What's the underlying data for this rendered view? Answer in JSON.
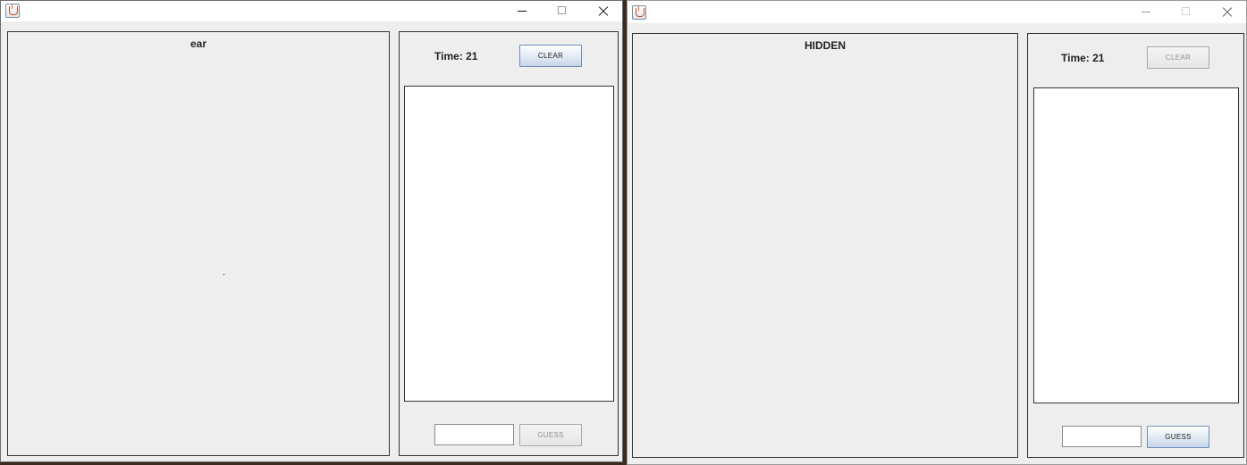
{
  "window_left": {
    "controls": {
      "minimize": "minimize-icon",
      "maximize": "maximize-icon",
      "close": "close-icon"
    },
    "drawing_panel": {
      "title": "ear"
    },
    "side_panel": {
      "timer": "Time: 21",
      "clear_label": "CLEAR",
      "guess_value": "",
      "guess_label": "GUESS"
    }
  },
  "window_right": {
    "controls": {
      "minimize": "minimize-icon",
      "maximize": "maximize-icon",
      "close": "close-icon"
    },
    "drawing_panel": {
      "title": "HIDDEN"
    },
    "side_panel": {
      "timer": "Time: 21",
      "clear_label": "CLEAR",
      "guess_value": "",
      "guess_label": "GUESS"
    }
  }
}
